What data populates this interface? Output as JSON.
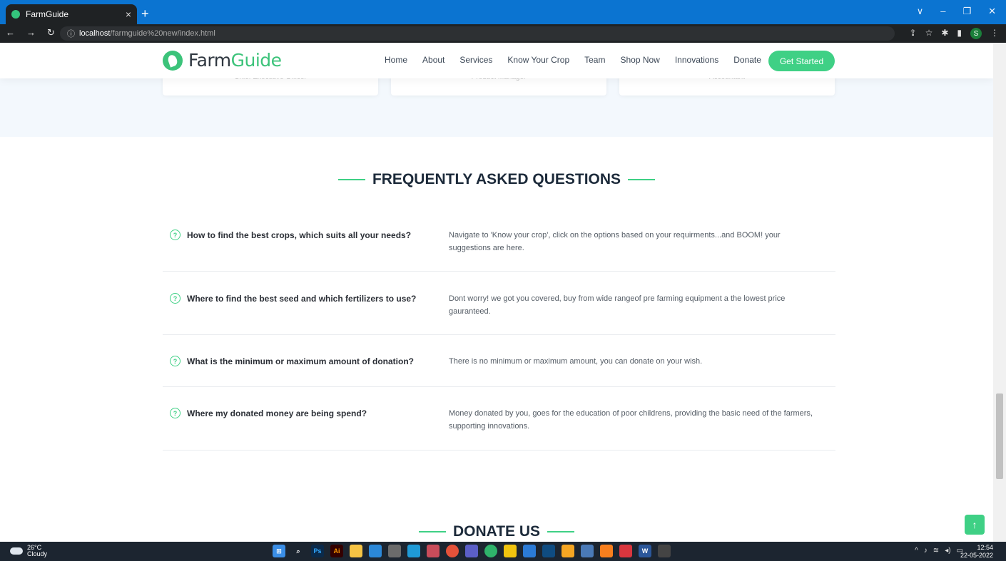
{
  "browser": {
    "tab_title": "FarmGuide",
    "tab_close": "×",
    "new_tab": "+",
    "url_host": "localhost",
    "url_path": "/farmguide%20new/index.html",
    "window_controls": [
      "∨",
      "–",
      "❐",
      "✕"
    ],
    "profile_initial": "S"
  },
  "header": {
    "logo_main": "Farm",
    "logo_accent": "Guide",
    "nav": [
      "Home",
      "About",
      "Services",
      "Know Your Crop",
      "Team",
      "Shop Now",
      "Innovations",
      "Donate"
    ],
    "cta": "Get Started"
  },
  "team": {
    "roles": [
      "Chief Executive Officer",
      "Product Manager",
      "Accountant"
    ]
  },
  "faq": {
    "title": "FREQUENTLY ASKED QUESTIONS",
    "items": [
      {
        "question": "How to find the best crops, which suits all your needs?",
        "answer": "Navigate to 'Know your crop', click on the options based on your requirments...and BOOM! your suggestions are here."
      },
      {
        "question": "Where to find the best seed and which fertilizers to use?",
        "answer": "Dont worry! we got you covered, buy from wide rangeof pre farming equipment a the lowest price gauranteed."
      },
      {
        "question": "What is the minimum or maximum amount of donation?",
        "answer": "There is no minimum or maximum amount, you can donate on your wish."
      },
      {
        "question": "Where my donated money are being spend?",
        "answer": "Money donated by you, goes for the education of poor childrens, providing the basic need of the farmers, supporting innovations."
      }
    ]
  },
  "donate": {
    "title": "DONATE US"
  },
  "taskbar": {
    "temperature": "26°C",
    "weather": "Cloudy",
    "time": "12:54",
    "date": "22-05-2022"
  },
  "icons": {
    "question": "question-circle-icon",
    "back_to_top": "arrow-up-icon"
  },
  "colors": {
    "accent": "#3fd085",
    "tabbar": "#0b74d1",
    "heading": "#1c2a3a"
  }
}
